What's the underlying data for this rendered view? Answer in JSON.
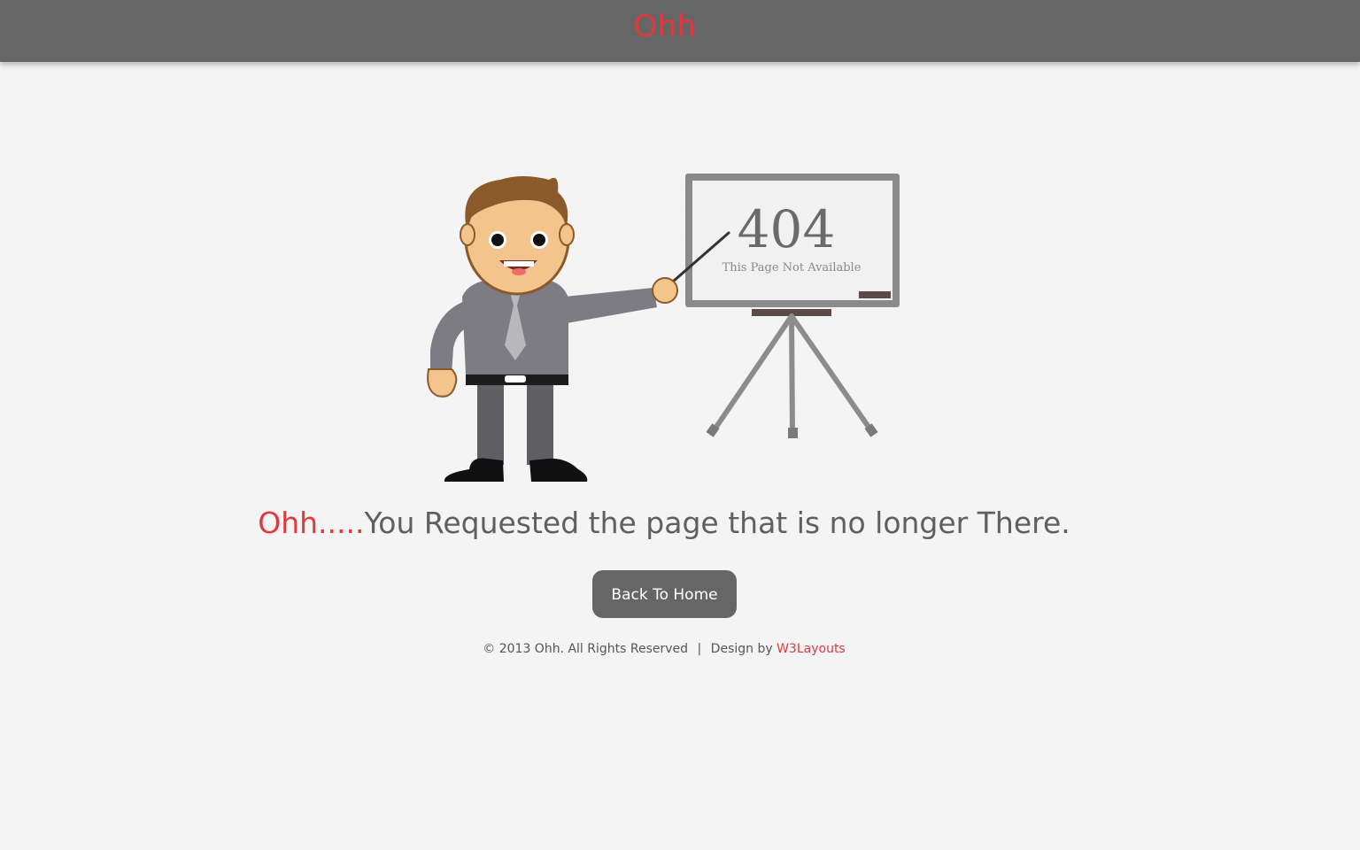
{
  "header": {
    "brand": "Ohh"
  },
  "illustration": {
    "board_code": "404",
    "board_caption": "This Page Not Available"
  },
  "main": {
    "message_accent": "Ohh.....",
    "message_text": "You Requested the page that is no longer There.",
    "home_button_label": "Back To Home"
  },
  "footer": {
    "copyright": "© 2013 Ohh. All Rights Reserved",
    "separator": "|",
    "design_by": "Design by",
    "designer_link": "W3Layouts"
  },
  "colors": {
    "accent": "#e0393e",
    "header_bg": "#666666",
    "page_bg": "#f4f4f4",
    "text": "#5f5f5f",
    "button_bg": "#666666"
  }
}
